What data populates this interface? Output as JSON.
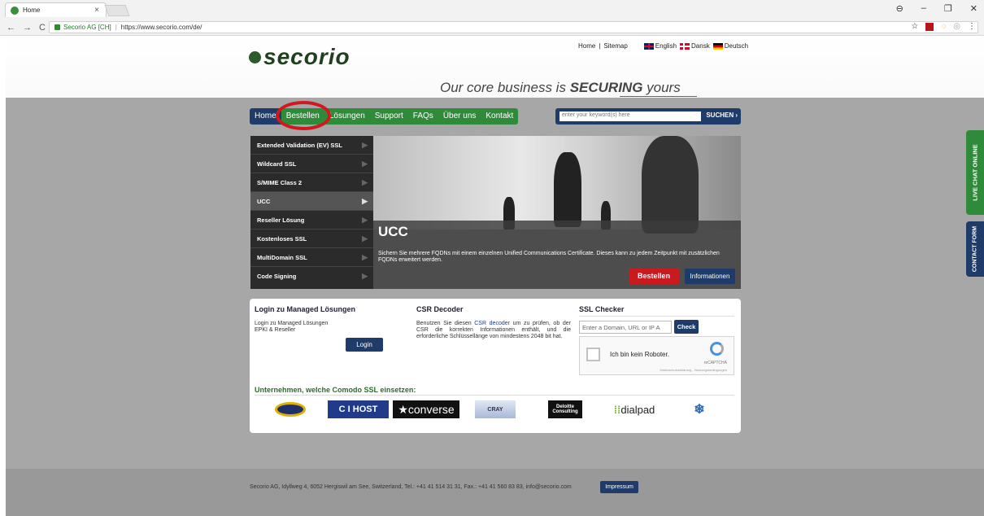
{
  "browser": {
    "tab_title": "Home",
    "tab_close": "×",
    "secure_label": "Secorio AG [CH]",
    "url": "https://www.secorio.com/de/",
    "window_controls": [
      "⊖",
      "–",
      "❐",
      "✕"
    ]
  },
  "header": {
    "logo_text": "secorio",
    "toplinks": {
      "home": "Home",
      "sep": "|",
      "sitemap": "Sitemap",
      "english": "English",
      "dansk": "Dansk",
      "deutsch": "Deutsch"
    },
    "tagline_pre": "Our core business  is ",
    "tagline_bold": "SECURING",
    "tagline_post": " yours"
  },
  "nav": {
    "items": [
      "Home",
      "Bestellen",
      "Lösungen",
      "Support",
      "FAQs",
      "Über uns",
      "Kontakt"
    ],
    "search_placeholder": "enter your keyword(s) here",
    "search_button": "SUCHEN ›"
  },
  "sidebar": {
    "items": [
      "Extended Validation (EV) SSL",
      "Wildcard SSL",
      "S/MIME Class 2",
      "UCC",
      "Reseller Lösung",
      "Kostenloses SSL",
      "MultiDomain SSL",
      "Code Signing"
    ],
    "active_index": 3
  },
  "hero": {
    "title": "UCC",
    "description": "Sichern Sie mehrere FQDNs mit einem einzelnen Unified Communications Certificate. Dieses kann zu jedem Zeitpunkt mit zusätzlichen FQDNs erweitert werden.",
    "order_button": "Bestellen",
    "info_button": "Informationen"
  },
  "panel": {
    "login": {
      "heading": "Login zu Managed Lösungen",
      "line1": "Login zu Managed Lösungen",
      "line2": "EPKI & Reseller",
      "button": "Login"
    },
    "csr": {
      "heading": "CSR Decoder",
      "text_pre": "Benutzen Sie diesen ",
      "link": "CSR decoder",
      "text_post": " um zu prüfen, ob der CSR die korrekten Informationen enthält, und die erforderliche Schlüssellänge von mindestens 2048 bit hat."
    },
    "ssl": {
      "heading": "SSL Checker",
      "placeholder": "Enter a Domain, URL or IP A",
      "button": "Check",
      "captcha_label": "Ich bin kein Roboter.",
      "captcha_brand": "reCAPTCHA",
      "captcha_small": "Datenschutzerklärung - Nutzungsbedingungen"
    },
    "partners_heading": "Unternehmen, welche Comodo SSL einsetzen:",
    "partners": [
      "C I HOST",
      "converse",
      "CRAY",
      "Deloitte Consulting",
      "dialpad"
    ]
  },
  "footer": {
    "text": "Secorio AG, Idyllweg 4, 6052 Hergiswil am See, Switzerland, Tel.: +41 41 514 31 31, Fax.: +41 41 560 83 83, info@secorio.com",
    "impressum": "Impressum"
  },
  "side_tabs": {
    "live_chat": "LIVE CHAT ONLINE",
    "contact": "CONTACT FORM"
  },
  "colors": {
    "nav_blue": "#1f3b6a",
    "nav_green": "#2f8b3a",
    "order_red": "#c81a1f",
    "annotation_circle": "#d3181d"
  }
}
